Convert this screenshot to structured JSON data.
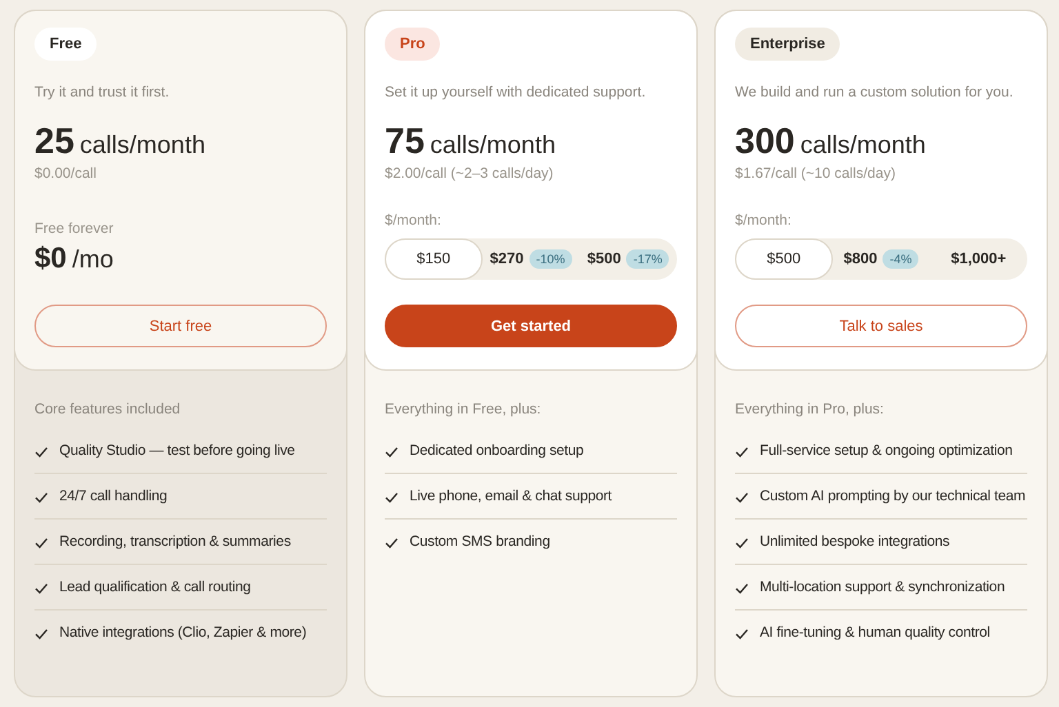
{
  "plans": [
    {
      "kind": "free",
      "badge": {
        "text": "Free"
      },
      "tagline": "Try it and trust it first.",
      "calls": "25",
      "calls_unit": "calls/month",
      "per_call": "$0.00/call",
      "price_note": "Free forever",
      "price": "$0",
      "price_unit": "/mo",
      "cta": {
        "label": "Start free"
      },
      "features_heading": "Core features included",
      "features": [
        "Quality Studio — test before going live",
        "24/7 call handling",
        "Recording, transcription & summaries",
        "Lead qualification & call routing",
        "Native integrations (Clio, Zapier & more)"
      ]
    },
    {
      "kind": "pro",
      "badge": {
        "text": "Pro"
      },
      "tagline": "Set it up yourself with dedicated support.",
      "calls": "75",
      "calls_unit": "calls/month",
      "per_call": "$2.00/call (~2–3 calls/day)",
      "options_label": "$/month:",
      "options": [
        {
          "label": "$150",
          "selected": true
        },
        {
          "label": "$270",
          "discount": "-10%",
          "selected": false
        },
        {
          "label": "$500",
          "discount": "-17%",
          "selected": false
        }
      ],
      "cta": {
        "label": "Get started"
      },
      "features_heading": "Everything in Free, plus:",
      "features": [
        "Dedicated onboarding setup",
        "Live phone, email & chat support",
        "Custom SMS branding"
      ]
    },
    {
      "kind": "enterprise",
      "badge": {
        "text": "Enterprise"
      },
      "tagline": "We build and run a custom solution for you.",
      "calls": "300",
      "calls_unit": "calls/month",
      "per_call": "$1.67/call (~10 calls/day)",
      "options_label": "$/month:",
      "options": [
        {
          "label": "$500",
          "selected": true
        },
        {
          "label": "$800",
          "discount": "-4%",
          "selected": false
        },
        {
          "label": "$1,000+",
          "selected": false
        }
      ],
      "cta": {
        "label": "Talk to sales"
      },
      "features_heading": "Everything in Pro, plus:",
      "features": [
        "Full-service setup & ongoing optimization",
        "Custom AI prompting by our technical team",
        "Unlimited bespoke integrations",
        "Multi-location support & synchronization",
        "AI fine-tuning & human quality control"
      ]
    }
  ]
}
